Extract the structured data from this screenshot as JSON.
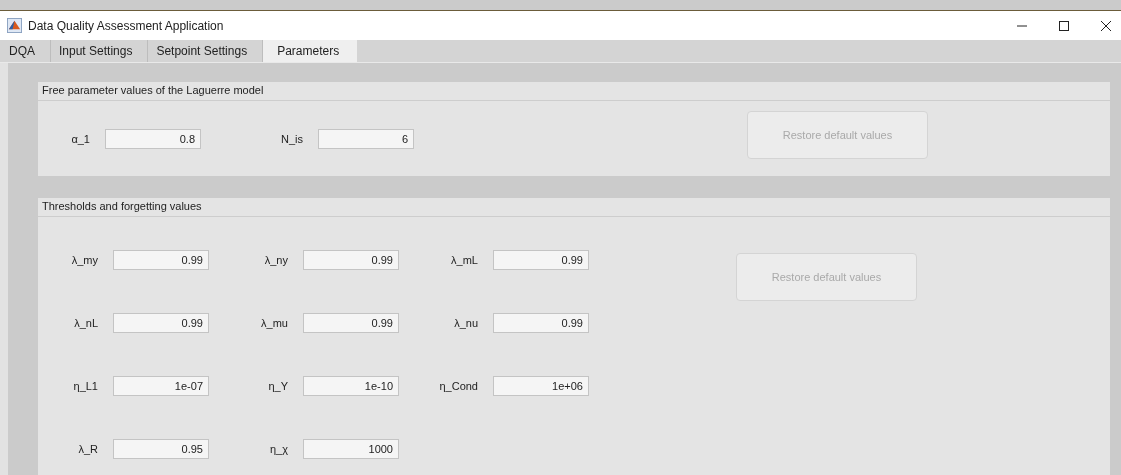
{
  "window": {
    "title": "Data Quality Assessment Application"
  },
  "tabs": [
    {
      "label": "DQA",
      "selected": false
    },
    {
      "label": "Input Settings",
      "selected": false
    },
    {
      "label": "Setpoint Settings",
      "selected": false
    },
    {
      "label": "Parameters",
      "selected": true
    }
  ],
  "panels": [
    {
      "title": "Free parameter values of the Laguerre model",
      "fields": [
        [
          {
            "label": "α_1",
            "value": "0.8"
          },
          {
            "label": "N_is",
            "value": "6"
          }
        ]
      ],
      "button": {
        "label": "Restore default values",
        "disabled": true
      }
    },
    {
      "title": "Thresholds and forgetting values",
      "fields": [
        [
          {
            "label": "λ_my",
            "value": "0.99"
          },
          {
            "label": "λ_ny",
            "value": "0.99"
          },
          {
            "label": "λ_mL",
            "value": "0.99"
          }
        ],
        [
          {
            "label": "λ_nL",
            "value": "0.99"
          },
          {
            "label": "λ_mu",
            "value": "0.99"
          },
          {
            "label": "λ_nu",
            "value": "0.99"
          }
        ],
        [
          {
            "label": "η_L1",
            "value": "1e-07"
          },
          {
            "label": "η_Y",
            "value": "1e-10"
          },
          {
            "label": "η_Cond",
            "value": "1e+06"
          }
        ],
        [
          {
            "label": "λ_R",
            "value": "0.95"
          },
          {
            "label": "η_χ",
            "value": "1000"
          }
        ]
      ],
      "button": {
        "label": "Restore default values",
        "disabled": true
      }
    }
  ]
}
